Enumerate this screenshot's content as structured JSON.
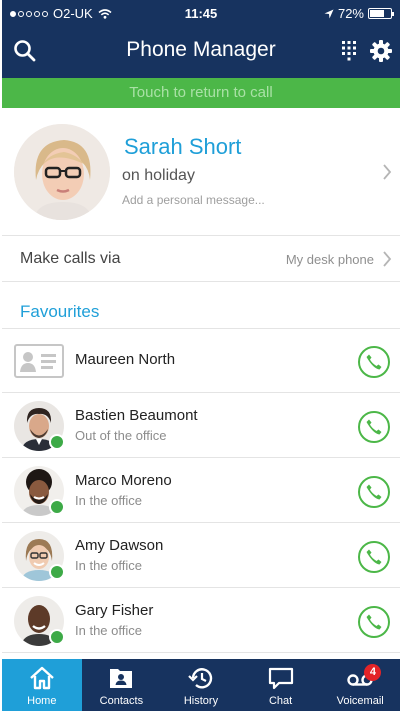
{
  "status_bar": {
    "carrier": "O2-UK",
    "time": "11:45",
    "battery": "72%",
    "signal_bars_filled": 1,
    "battery_level": 0.72
  },
  "header": {
    "title": "Phone Manager",
    "search_icon": "search-icon",
    "dialpad_icon": "dialpad-icon",
    "settings_icon": "gear-icon"
  },
  "call_banner": {
    "text": "Touch to return to call"
  },
  "profile": {
    "name": "Sarah Short",
    "status": "on holiday",
    "message_placeholder": "Add a personal message..."
  },
  "make_calls": {
    "label": "Make calls via",
    "value": "My desk phone"
  },
  "favourites": {
    "title": "Favourites",
    "contacts": [
      {
        "name": "Maureen North",
        "subtitle": ""
      },
      {
        "name": "Bastien Beaumont",
        "subtitle": "Out of the office"
      },
      {
        "name": "Marco Moreno",
        "subtitle": "In the office"
      },
      {
        "name": "Amy Dawson",
        "subtitle": "In the office"
      },
      {
        "name": "Gary Fisher",
        "subtitle": "In the office"
      }
    ]
  },
  "tabs": [
    {
      "label": "Home",
      "icon": "home-icon"
    },
    {
      "label": "Contacts",
      "icon": "contacts-icon"
    },
    {
      "label": "History",
      "icon": "history-icon"
    },
    {
      "label": "Chat",
      "icon": "chat-icon"
    },
    {
      "label": "Voicemail",
      "icon": "voicemail-icon",
      "badge": "4"
    }
  ],
  "colors": {
    "header_bg": "#17335f",
    "accent_blue": "#1f9fd8",
    "call_green": "#4cb748",
    "presence_green": "#3daa47",
    "badge_red": "#e32428"
  }
}
